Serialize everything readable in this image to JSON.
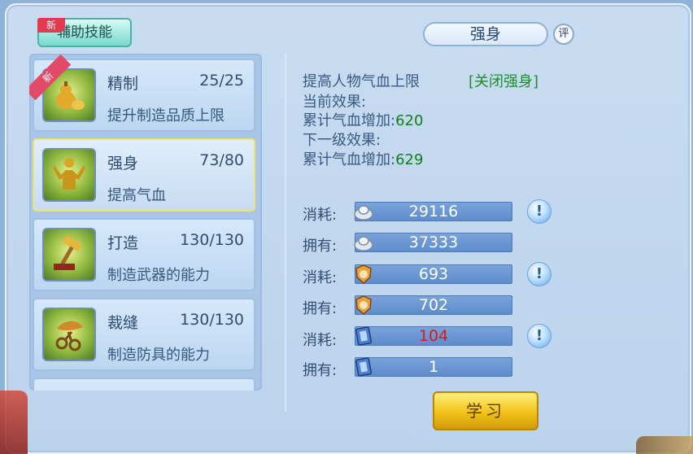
{
  "tab": {
    "label": "辅助技能",
    "new_tag": "新"
  },
  "skills": [
    {
      "name": "精制",
      "level": "25/25",
      "desc": "提升制造品质上限",
      "ribbon": "新",
      "icon": "gourd-icon"
    },
    {
      "name": "强身",
      "level": "73/80",
      "desc": "提高气血",
      "icon": "muscle-man-icon"
    },
    {
      "name": "打造",
      "level": "130/130",
      "desc": "制造武器的能力",
      "icon": "hammer-icon"
    },
    {
      "name": "裁缝",
      "level": "130/130",
      "desc": "制造防具的能力",
      "icon": "scissors-icon"
    }
  ],
  "detail": {
    "title": "强身",
    "eval_label": "评",
    "summary": "提高人物气血上限",
    "toggle": "[关闭强身]",
    "current_label": "当前效果:",
    "current_text": "累计气血增加:",
    "current_value": "620",
    "next_label": "下一级效果:",
    "next_text": "累计气血增加:",
    "next_value": "629"
  },
  "resources": [
    {
      "label": "消耗:",
      "value": "29116",
      "icon": "silver-ingot-icon",
      "hint": "!",
      "warn": false
    },
    {
      "label": "拥有:",
      "value": "37333",
      "icon": "silver-ingot-icon"
    },
    {
      "label": "消耗:",
      "value": "693",
      "icon": "contribution-badge-icon",
      "hint": "!",
      "warn": false
    },
    {
      "label": "拥有:",
      "value": "702",
      "icon": "contribution-badge-icon"
    },
    {
      "label": "消耗:",
      "value": "104",
      "icon": "skill-book-icon",
      "hint": "!",
      "warn": true
    },
    {
      "label": "拥有:",
      "value": "1",
      "icon": "skill-book-icon"
    }
  ],
  "learn_button": "学习",
  "colors": {
    "accent_green": "#0f7f17",
    "warn_red": "#e01717",
    "selection": "#f2e26b"
  }
}
